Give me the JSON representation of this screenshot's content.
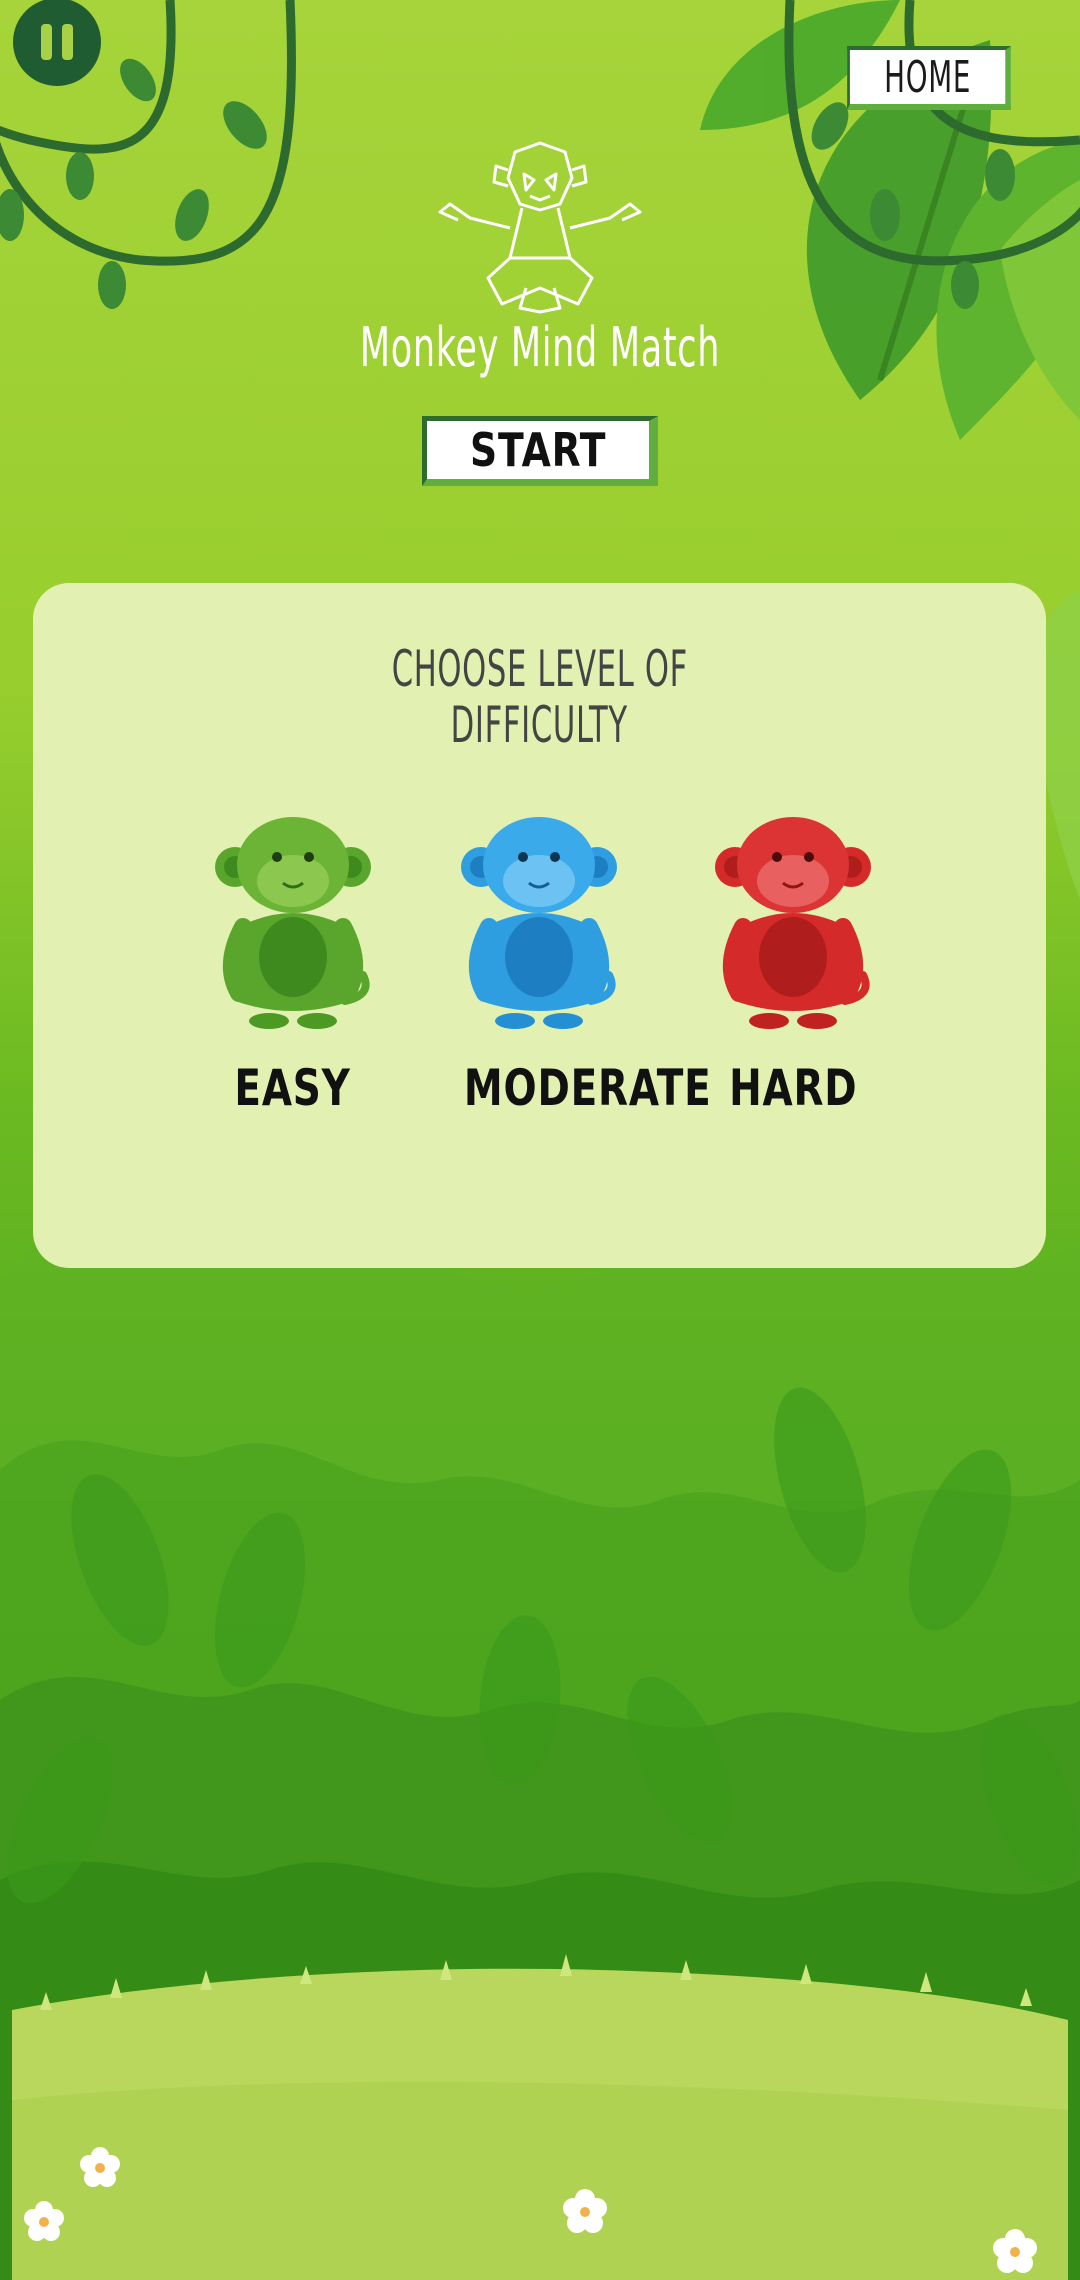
{
  "header": {
    "home_label": "HOME",
    "title": "Monkey Mind Match",
    "start_label": "START"
  },
  "difficulty": {
    "heading_line1": "CHOOSE LEVEL OF",
    "heading_line2": "DIFFICULTY",
    "levels": [
      {
        "label": "EASY",
        "color": "#5aa62c",
        "icon": "green-monkey-icon"
      },
      {
        "label": "MODERATE",
        "color": "#2f9ee0",
        "icon": "blue-monkey-icon"
      },
      {
        "label": "HARD",
        "color": "#d42a2a",
        "icon": "red-monkey-icon"
      }
    ]
  },
  "colors": {
    "accent_dark": "#1f5c32",
    "panel": "#e2f0b1",
    "jungle": "#6cba22"
  }
}
